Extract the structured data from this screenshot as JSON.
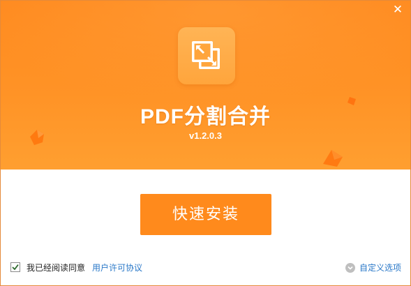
{
  "window": {
    "close_symbol": "✕"
  },
  "app": {
    "name": "PDF分割合并",
    "version": "v1.2.0.3",
    "icon": "split-merge-icon"
  },
  "install_button": {
    "label": "快速安装"
  },
  "footer": {
    "agree_checked": true,
    "agree_label": "我已经阅读同意",
    "license_link": "用户许可协议",
    "custom_options": "自定义选项"
  },
  "colors": {
    "accent": "#ff8a1c",
    "link": "#2a78c8"
  }
}
